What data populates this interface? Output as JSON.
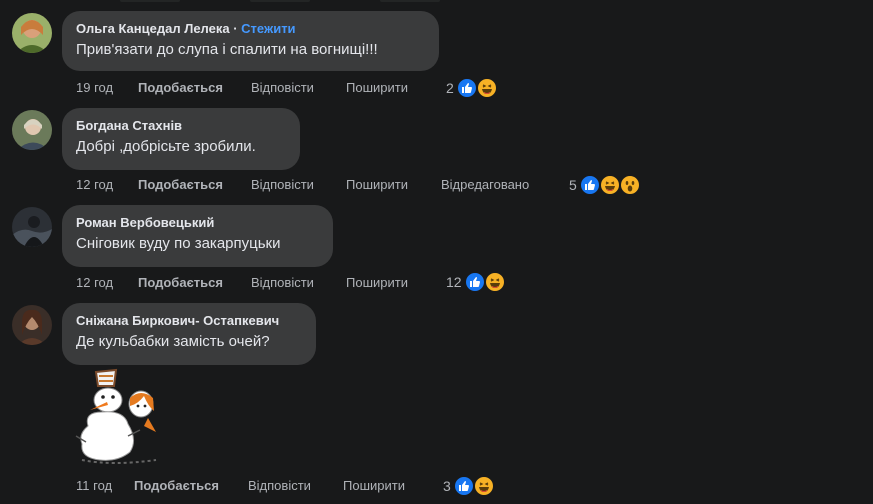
{
  "comments": [
    {
      "author": "Ольга Канцедал Лелека",
      "separator": " · ",
      "follow": "Стежити",
      "text": "Прив'язати до слупа і спалити на вогнищі!!!",
      "time": "19 год",
      "like": "Подобається",
      "reply": "Відповісти",
      "share": "Поширити",
      "reaction_count": "2",
      "reactions": [
        "like-icon",
        "haha-icon"
      ]
    },
    {
      "author": "Богдана Стахнів",
      "text": "Добрі ,добрісьте зробили.",
      "time": "12 год",
      "like": "Подобається",
      "reply": "Відповісти",
      "share": "Поширити",
      "edited": "Відредаговано",
      "reaction_count": "5",
      "reactions": [
        "like-icon",
        "haha-icon",
        "wow-icon"
      ]
    },
    {
      "author": "Роман Вербовецький",
      "text": "Сніговик вуду по закарпуцьки",
      "time": "12 год",
      "like": "Подобається",
      "reply": "Відповісти",
      "share": "Поширити",
      "reaction_count": "12",
      "reactions": [
        "like-icon",
        "haha-icon"
      ]
    },
    {
      "author": "Сніжана Биркович- Остапкевич",
      "text": "Де кульбабки замість очей?",
      "time": "11 год",
      "like": "Подобається",
      "reply": "Відповісти",
      "share": "Поширити",
      "reaction_count": "3",
      "reactions": [
        "like-icon",
        "haha-icon"
      ],
      "attachment": "snowman-sticker"
    }
  ],
  "colors": {
    "background": "#18191a",
    "bubble": "#3a3b3c",
    "text": "#e4e6eb",
    "secondary_text": "#b0b3b8",
    "link": "#4599ff",
    "like_reaction": "#1877f2",
    "haha_reaction": "#f7b125"
  }
}
